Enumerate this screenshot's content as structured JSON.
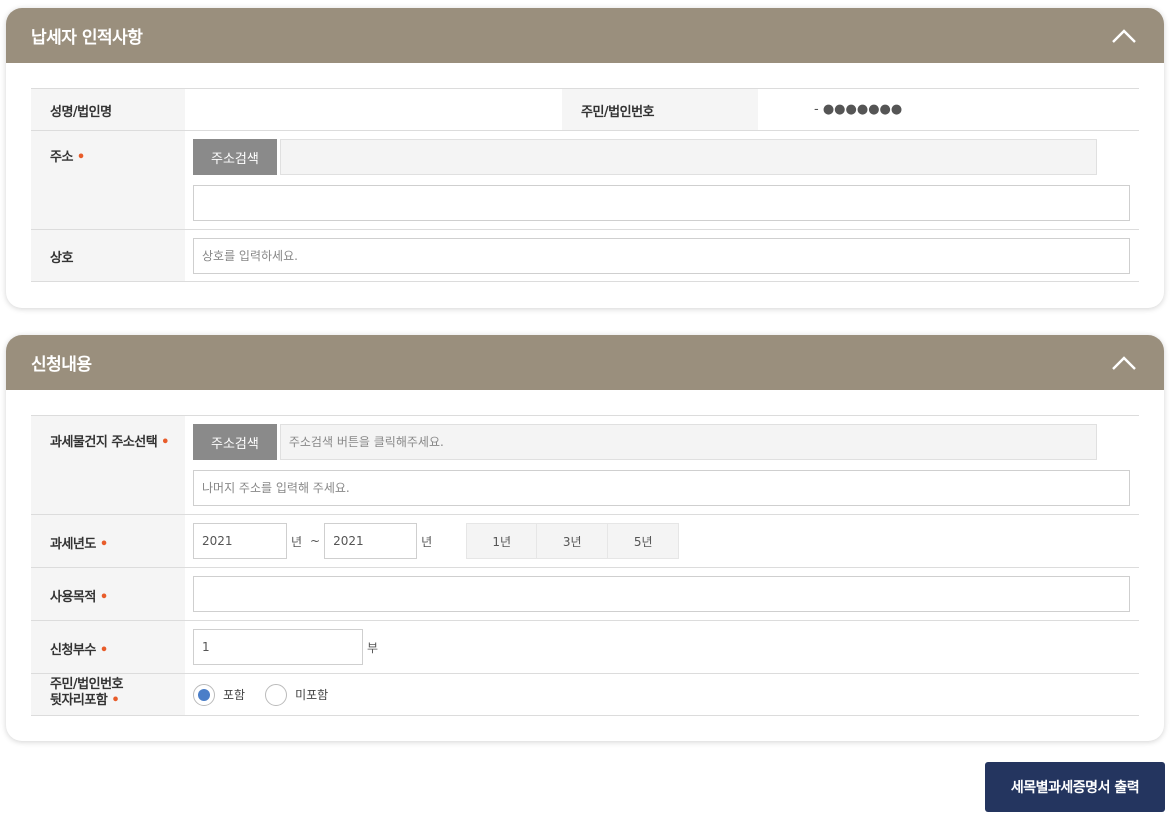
{
  "section1": {
    "title": "납세자 인적사항",
    "name_label": "성명/법인명",
    "name_value": "",
    "id_label": "주민/법인번호",
    "id_value": "- ●●●●●●●",
    "address_label": "주소",
    "address_search_btn": "주소검색",
    "address_value": "",
    "address_detail_value": "",
    "business_label": "상호",
    "business_placeholder": "상호를 입력하세요."
  },
  "section2": {
    "title": "신청내용",
    "tax_address_label": "과세물건지 주소선택",
    "address_search_btn": "주소검색",
    "address_placeholder": "주소검색 버튼을 클릭해주세요.",
    "address_detail_placeholder": "나머지 주소를 입력해 주세요.",
    "tax_year_label": "과세년도",
    "year_from": "2021",
    "year_unit": "년",
    "tilde": "~",
    "year_to": "2021",
    "year_buttons": [
      "1년",
      "3년",
      "5년"
    ],
    "purpose_label": "사용목적",
    "purpose_value": "",
    "copies_label": "신청부수",
    "copies_value": "1",
    "copies_unit": "부",
    "id_suffix_label_line1": "주민/법인번호",
    "id_suffix_label_line2": "뒷자리포함",
    "radio_include": "포함",
    "radio_exclude": "미포함",
    "selected": "include"
  },
  "required_mark": "•",
  "submit_label": "세목별과세증명서 출력",
  "colors": {
    "header_bg": "#9a8f7d",
    "submit_bg": "#24355f",
    "required": "#e85c2a",
    "radio_selected": "#4a7ec8"
  },
  "icons": {
    "collapse": "chevron-up-icon"
  }
}
